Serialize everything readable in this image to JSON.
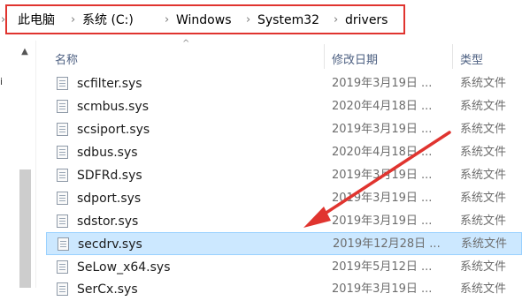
{
  "breadcrumb": {
    "items": [
      "此电脑",
      "系统 (C:)",
      "Windows",
      "System32",
      "drivers"
    ]
  },
  "nav": {
    "letter": "i"
  },
  "columns": {
    "name": "名称",
    "modified": "修改日期",
    "type": "类型"
  },
  "files": [
    {
      "name": "scfilter.sys",
      "date": "2019年3月19日 ...",
      "type": "系统文件"
    },
    {
      "name": "scmbus.sys",
      "date": "2020年4月18日 ...",
      "type": "系统文件"
    },
    {
      "name": "scsiport.sys",
      "date": "2019年3月19日 ...",
      "type": "系统文件"
    },
    {
      "name": "sdbus.sys",
      "date": "2020年4月18日 ...",
      "type": "系统文件"
    },
    {
      "name": "SDFRd.sys",
      "date": "2019年3月19日 ...",
      "type": "系统文件"
    },
    {
      "name": "sdport.sys",
      "date": "2019年3月19日 ...",
      "type": "系统文件"
    },
    {
      "name": "sdstor.sys",
      "date": "2019年3月19日 ...",
      "type": "系统文件"
    },
    {
      "name": "secdrv.sys",
      "date": "2019年12月28日 ...",
      "type": "系统文件",
      "selected": true
    },
    {
      "name": "SeLow_x64.sys",
      "date": "2019年5月12日 ...",
      "type": "系统文件"
    },
    {
      "name": "SerCx.sys",
      "date": "2019年3月19日 ...",
      "type": "系统文件"
    }
  ],
  "colors": {
    "highlight": "#e0342f",
    "selection": "#cce8ff"
  }
}
